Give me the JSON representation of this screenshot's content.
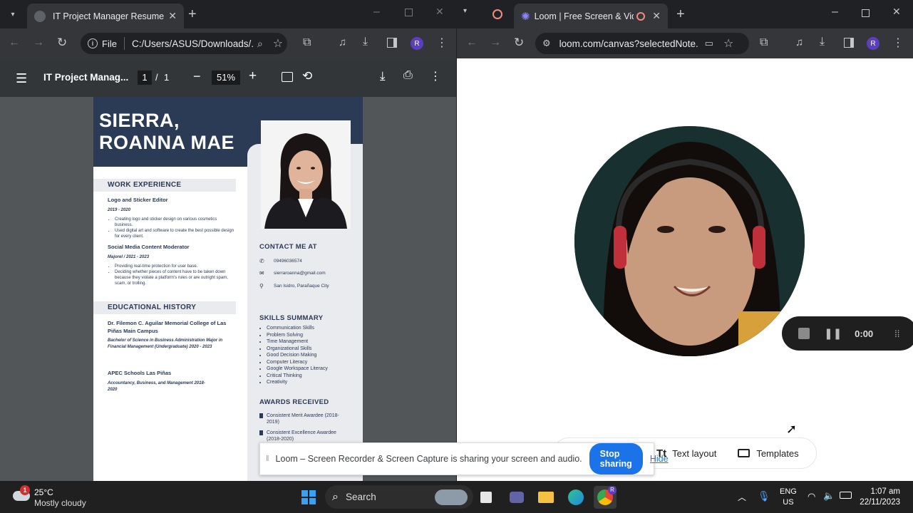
{
  "left_browser": {
    "tab_title": "IT Project Manager Resume",
    "address": "C:/Users/ASUS/Downloads/...",
    "address_scheme": "File",
    "profile_initial": "R"
  },
  "pdf_viewer": {
    "title": "IT Project Manag...",
    "page_current": "1",
    "page_sep": "/",
    "page_total": "1",
    "zoom": "51%"
  },
  "resume": {
    "name_line1": "SIERRA,",
    "name_line2": "ROANNA MAE",
    "work_heading": "WORK EXPERIENCE",
    "job1_title": "Logo and Sticker Editor",
    "job1_dates": "2019 - 2020",
    "job1_bullets": [
      "Creating logo and sticker design on various cosmetics business.",
      "Used digital art and software to create the best possible design for every client."
    ],
    "job2_title": "Social Media Content Moderator",
    "job2_dates": "Majorel / 2021 - 2023",
    "job2_bullets": [
      "Providing real-time protection for user base.",
      "Deciding whether pieces of content have to be taken down because they violate a platform's rules or are outright spam, scam, or trolling."
    ],
    "edu_heading": "EDUCATIONAL HISTORY",
    "edu1_school": "Dr. Filemon C. Aguilar Memorial College of Las Piñas Main Campus",
    "edu1_detail": "Bachelor of Science in Business Administration Major in Financial Management (Undergraduate) 2020 - 2023",
    "edu2_school": "APEC Schools Las Piñas",
    "edu2_detail": "Accountancy, Business, and Management 2018-2020",
    "contact_heading": "CONTACT ME AT",
    "phone": "09496036574",
    "email": "sierraroanna@gmail.com",
    "address": "San Isidro, Parañaque City",
    "skills_heading": "SKILLS SUMMARY",
    "skills": [
      "Communication Skills",
      "Problem Solving",
      "Time Management",
      "Organizational Skills",
      "Good Decision Making",
      "Computer Literacy",
      "Google Workspace Literacy",
      "Critical Thinking",
      "Creativity"
    ],
    "awards_heading": "AWARDS RECEIVED",
    "awards": [
      "Consistent Merit Awardee (2018-2019)",
      "Consistent Excellence Awardee (2018-2020)"
    ]
  },
  "right_browser": {
    "tab_title": "Loom | Free Screen & Video",
    "address": "loom.com/canvas?selectedNote...",
    "profile_initial": "R"
  },
  "loom": {
    "timer": "0:00",
    "text_layout_label": "Text layout",
    "templates_label": "Templates"
  },
  "share_bar": {
    "message": "Loom – Screen Recorder & Screen Capture is sharing your screen and audio.",
    "stop_label": "Stop sharing",
    "hide_label": "Hide"
  },
  "taskbar": {
    "weather_temp": "25°C",
    "weather_desc": "Mostly cloudy",
    "weather_badge": "1",
    "search_label": "Search",
    "lang_line1": "ENG",
    "lang_line2": "US",
    "time": "1:07 am",
    "date": "22/11/2023",
    "chrome_badge": "R"
  },
  "colors": {
    "resume_navy": "#2b3a55",
    "loom_accent": "#625df5",
    "stop_blue": "#1a73e8",
    "profile_purple": "#5c3fbf"
  }
}
